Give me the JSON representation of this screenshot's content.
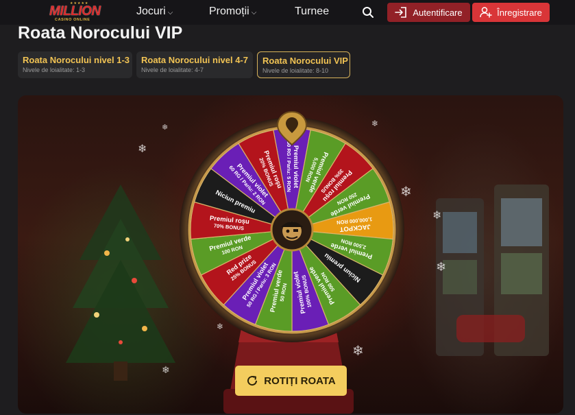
{
  "brand": {
    "logo_word": "MILLION",
    "logo_sub": "CASINO ONLINE"
  },
  "nav": {
    "items": [
      {
        "label": "Jocuri",
        "dropdown": true
      },
      {
        "label": "Promoții",
        "dropdown": true
      },
      {
        "label": "Turnee",
        "dropdown": false
      }
    ],
    "login_label": "Autentificare",
    "register_label": "Înregistrare"
  },
  "page": {
    "title": "Roata Norocului VIP"
  },
  "tabs": [
    {
      "title": "Roata Norocului nivel 1-3",
      "subtitle": "Nivele de loialitate: 1-3",
      "active": false
    },
    {
      "title": "Roata Norocului nivel 4-7",
      "subtitle": "Nivele de loialitate: 4-7",
      "active": false
    },
    {
      "title": "Roata Norocului VIP",
      "subtitle": "Nivele de loialitate: 8-10",
      "active": true
    }
  ],
  "wheel": {
    "segments": [
      {
        "lines": [
          "Premiul violet",
          "50 RG / Pariu: 5 RON"
        ],
        "color": "#6a1fb6"
      },
      {
        "lines": [
          "Premiul verde",
          "5,000 RON"
        ],
        "color": "#5a9c26"
      },
      {
        "lines": [
          "Premiul roșu",
          "35% BONUS"
        ],
        "color": "#b3141c"
      },
      {
        "lines": [
          "Premiul verde",
          "250 RON"
        ],
        "color": "#5a9c26"
      },
      {
        "lines": [
          "JACKPOT",
          "1,000,000 RON"
        ],
        "color": "#e89a12"
      },
      {
        "lines": [
          "Premiul verde",
          "2,500 RON"
        ],
        "color": "#5a9c26"
      },
      {
        "lines": [
          "Niciun premiu"
        ],
        "color": "#1c1c1c"
      },
      {
        "lines": [
          "Premiul verde",
          "500 RON"
        ],
        "color": "#5a9c26"
      },
      {
        "lines": [
          "Premiul violet",
          "100% BONUS"
        ],
        "color": "#6a1fb6"
      },
      {
        "lines": [
          "Premiul verde",
          "50 RON"
        ],
        "color": "#5a9c26"
      },
      {
        "lines": [
          "Premiul violet",
          "50 RG / Pariu: 3 RON"
        ],
        "color": "#6a1fb6"
      },
      {
        "lines": [
          "Red prize",
          "25% BONUS"
        ],
        "color": "#b3141c"
      },
      {
        "lines": [
          "Premiul verde",
          "100 RON"
        ],
        "color": "#5a9c26"
      },
      {
        "lines": [
          "Premiul roșu",
          "70% BONUS"
        ],
        "color": "#b3141c"
      },
      {
        "lines": [
          "Niciun premiu"
        ],
        "color": "#1c1c1c"
      },
      {
        "lines": [
          "Premiul violet",
          "60 RG / Pariu: 2 RON"
        ],
        "color": "#6a1fb6"
      },
      {
        "lines": [
          "Premiul roșu",
          "20% BONUS"
        ],
        "color": "#b3141c"
      }
    ]
  },
  "spin_button": {
    "label": "ROTIȚI ROATA"
  },
  "colors": {
    "accent": "#f4cd5e",
    "login_bg": "#922127",
    "register_bg": "#d93538",
    "tab_title": "#f1c354"
  }
}
